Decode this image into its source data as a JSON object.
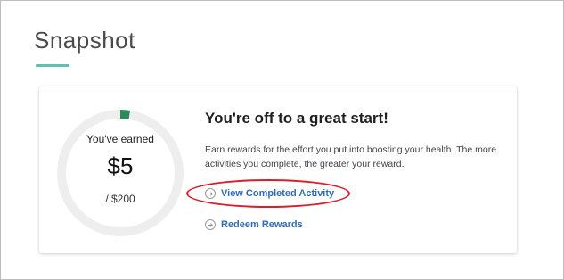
{
  "page": {
    "title": "Snapshot"
  },
  "rewards": {
    "earned_label": "You've earned",
    "amount": "$5",
    "goal": "/ $200",
    "progress_fraction": 0.025,
    "headline": "You're off to a great start!",
    "description": "Earn rewards for the effort you put into boosting your health. The more activities you complete, the greater your reward."
  },
  "links": {
    "view_completed": "View Completed Activity",
    "redeem": "Redeem Rewards"
  },
  "colors": {
    "accent_teal": "#5fbfb3",
    "progress_green": "#2e8b57",
    "ring_gray": "#eeeeee",
    "link_blue": "#2f6db5",
    "highlight_red": "#d81e2c"
  },
  "icons": {
    "link_icon": "circle-arrow-right-icon"
  }
}
